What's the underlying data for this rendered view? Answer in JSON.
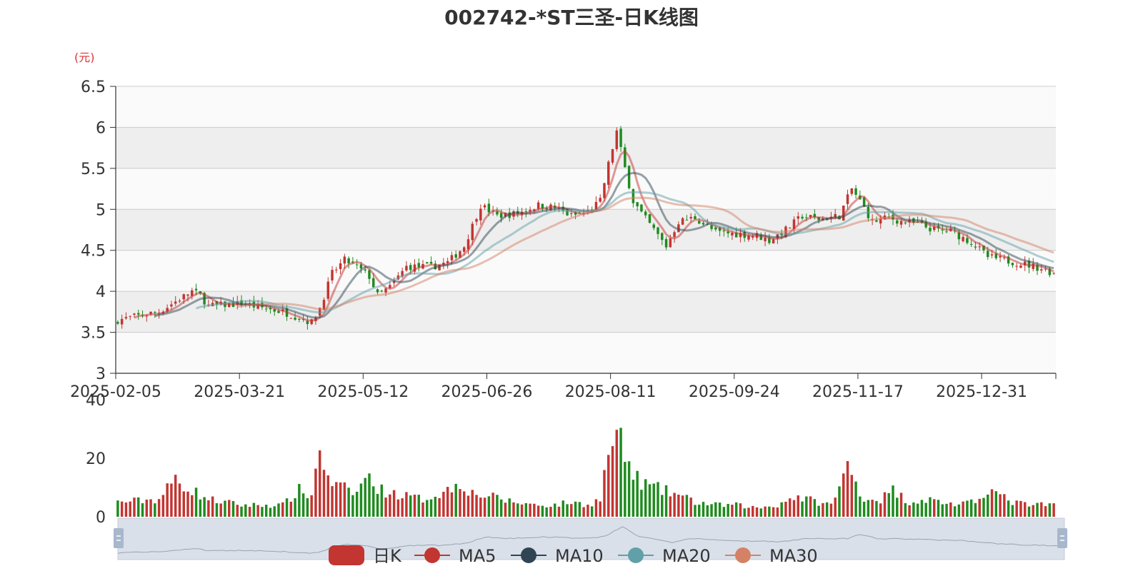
{
  "colors": {
    "up": "#c23531",
    "down": "#1f8b1f",
    "ma5": "#c23531",
    "ma10": "#2f4554",
    "ma20": "#61a0a8",
    "ma30": "#d48265",
    "grid_band": "#eeeeee",
    "grid_line": "#cccccc",
    "unit": "#dd3333",
    "zoom_fill": "#d9e0ea",
    "zoom_line": "#9aa3b0"
  },
  "chart_data": {
    "type": "candlestick",
    "title": "002742-*ST三圣-日K线图",
    "price_axis": {
      "unit_label": "(元)",
      "ylim": [
        3,
        6.5
      ],
      "ticks": [
        "3",
        "3.5",
        "4",
        "4.5",
        "5",
        "5.5",
        "6",
        "6.5"
      ]
    },
    "volume_axis": {
      "ylim": [
        0,
        40
      ],
      "ticks": [
        "0",
        "20",
        "40"
      ]
    },
    "x_axis": {
      "dates": [
        "2025-02-05",
        "2025-03-21",
        "2025-05-12",
        "2025-06-26",
        "2025-08-11",
        "2025-09-24",
        "2025-11-17",
        "2025-12-31"
      ],
      "tick_labels": [
        "2025-02-05",
        "2025-03-21",
        "2025-05-12",
        "2025-06-26",
        "2025-08-11",
        "2025-09-24",
        "2025-11-17",
        "2025-12-31"
      ]
    },
    "legend": [
      {
        "name": "日K",
        "color": "#c23531",
        "shape": "rect"
      },
      {
        "name": "MA5",
        "color": "#c23531",
        "shape": "circle"
      },
      {
        "name": "MA10",
        "color": "#2f4554",
        "shape": "circle"
      },
      {
        "name": "MA20",
        "color": "#61a0a8",
        "shape": "circle"
      },
      {
        "name": "MA30",
        "color": "#d48265",
        "shape": "circle"
      }
    ],
    "close_keypoints": [
      [
        0,
        3.65
      ],
      [
        10,
        3.75
      ],
      [
        18,
        4.0
      ],
      [
        20,
        3.95
      ],
      [
        22,
        3.82
      ],
      [
        30,
        3.85
      ],
      [
        40,
        3.75
      ],
      [
        44,
        3.68
      ],
      [
        47,
        3.62
      ],
      [
        49,
        3.8
      ],
      [
        52,
        4.22
      ],
      [
        55,
        4.38
      ],
      [
        58,
        4.3
      ],
      [
        61,
        4.18
      ],
      [
        63,
        3.95
      ],
      [
        66,
        4.05
      ],
      [
        70,
        4.3
      ],
      [
        76,
        4.3
      ],
      [
        80,
        4.35
      ],
      [
        84,
        4.55
      ],
      [
        88,
        5.05
      ],
      [
        92,
        4.92
      ],
      [
        97,
        4.95
      ],
      [
        102,
        5.05
      ],
      [
        106,
        5.02
      ],
      [
        110,
        4.92
      ],
      [
        114,
        4.97
      ],
      [
        117,
        5.1
      ],
      [
        119,
        5.55
      ],
      [
        121,
        5.95
      ],
      [
        123,
        5.5
      ],
      [
        125,
        5.1
      ],
      [
        127,
        4.95
      ],
      [
        130,
        4.75
      ],
      [
        133,
        4.55
      ],
      [
        136,
        4.85
      ],
      [
        140,
        4.9
      ],
      [
        145,
        4.72
      ],
      [
        150,
        4.7
      ],
      [
        155,
        4.68
      ],
      [
        158,
        4.62
      ],
      [
        162,
        4.75
      ],
      [
        166,
        4.92
      ],
      [
        170,
        4.88
      ],
      [
        175,
        4.92
      ],
      [
        178,
        5.25
      ],
      [
        180,
        5.1
      ],
      [
        183,
        4.85
      ],
      [
        187,
        4.9
      ],
      [
        190,
        4.85
      ],
      [
        194,
        4.82
      ],
      [
        198,
        4.75
      ],
      [
        202,
        4.73
      ],
      [
        207,
        4.6
      ],
      [
        211,
        4.42
      ],
      [
        215,
        4.38
      ],
      [
        220,
        4.33
      ],
      [
        224,
        4.28
      ],
      [
        227,
        4.22
      ]
    ],
    "volume_keypoints": [
      [
        0,
        5
      ],
      [
        10,
        6
      ],
      [
        14,
        13
      ],
      [
        18,
        9
      ],
      [
        22,
        6
      ],
      [
        30,
        4
      ],
      [
        40,
        4
      ],
      [
        44,
        9
      ],
      [
        47,
        7
      ],
      [
        49,
        25
      ],
      [
        51,
        12
      ],
      [
        54,
        10
      ],
      [
        58,
        8
      ],
      [
        60,
        14
      ],
      [
        64,
        9
      ],
      [
        70,
        7
      ],
      [
        74,
        6
      ],
      [
        80,
        9
      ],
      [
        83,
        12
      ],
      [
        86,
        8
      ],
      [
        90,
        7
      ],
      [
        96,
        5
      ],
      [
        102,
        4
      ],
      [
        106,
        4
      ],
      [
        110,
        5
      ],
      [
        114,
        4
      ],
      [
        117,
        6
      ],
      [
        119,
        22
      ],
      [
        121,
        28
      ],
      [
        123,
        21
      ],
      [
        125,
        14
      ],
      [
        128,
        11
      ],
      [
        132,
        9
      ],
      [
        135,
        8
      ],
      [
        140,
        5
      ],
      [
        145,
        4
      ],
      [
        150,
        4
      ],
      [
        155,
        3
      ],
      [
        160,
        4
      ],
      [
        164,
        7
      ],
      [
        167,
        6
      ],
      [
        170,
        5
      ],
      [
        173,
        4
      ],
      [
        175,
        10
      ],
      [
        177,
        17
      ],
      [
        179,
        12
      ],
      [
        181,
        6
      ],
      [
        185,
        6
      ],
      [
        188,
        9
      ],
      [
        192,
        5
      ],
      [
        196,
        6
      ],
      [
        200,
        5
      ],
      [
        204,
        4
      ],
      [
        208,
        5
      ],
      [
        211,
        10
      ],
      [
        214,
        7
      ],
      [
        217,
        5
      ],
      [
        221,
        4
      ],
      [
        224,
        4
      ],
      [
        227,
        4
      ]
    ],
    "num_days": 228
  }
}
